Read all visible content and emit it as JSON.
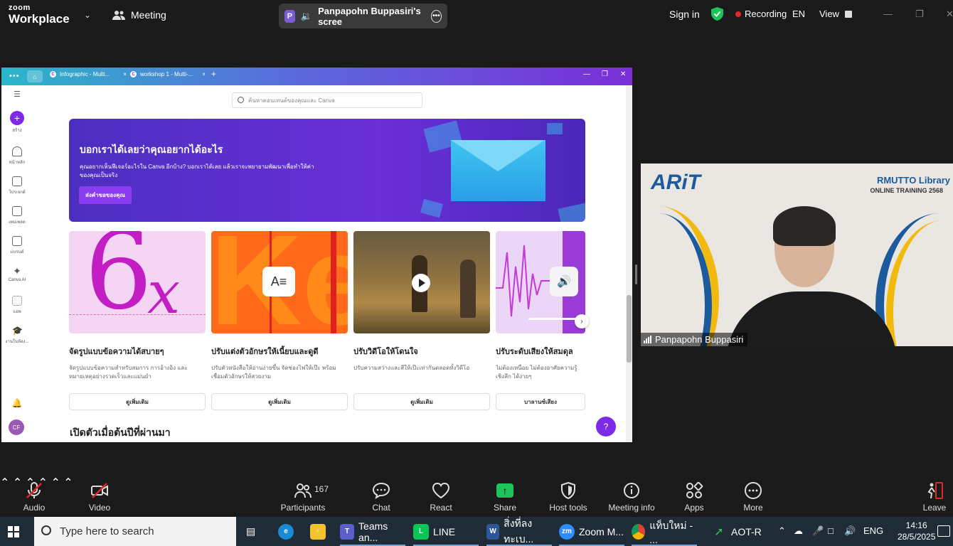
{
  "zoom": {
    "logo_line1": "zoom",
    "logo_line2": "Workplace",
    "meeting_label": "Meeting",
    "share_badge": "P",
    "share_label": "Panpapohn Buppasiri's scree",
    "sign_in": "Sign in",
    "recording": "Recording",
    "language": "EN",
    "view": "View",
    "accent_green": "#1ec45a",
    "recording_color": "#e02828"
  },
  "canva": {
    "tabs": [
      {
        "label": "Infographic - Multi..."
      },
      {
        "label": "workshop 1 - Multi-..."
      }
    ],
    "search_placeholder": "ค้นหาคอนเทนต์ของคุณและ Canva",
    "sidebar": [
      {
        "label": "สร้าง"
      },
      {
        "label": "หน้าหลัก"
      },
      {
        "label": "โปรเจกต์"
      },
      {
        "label": "เทมเพลต"
      },
      {
        "label": "แบรนด์"
      },
      {
        "label": "Canva AI"
      },
      {
        "label": "แอพ"
      },
      {
        "label": "งานในห้อง..."
      }
    ],
    "avatar_initials": "CF",
    "hero": {
      "title": "บอกเราได้เลยว่าคุณอยากได้อะไร",
      "text": "คุณอยากเห็นฟีเจอร์อะไรใน Canva อีกบ้าง? บอกเราได้เลย แล้วเราจะพยายามพัฒนาเพื่อทำให้ค่าของคุณเป็นจริง",
      "button": "ส่งคำขอของคุณ"
    },
    "cards": [
      {
        "title": "จัดรูปแบบข้อความได้สบายๆ",
        "desc": "จัดรูปแบบข้อความสำหรับสมการ การอ้างอิง และหมายเหตุอย่างรวดเร็วและแม่นยำ",
        "button": "ดูเพิ่มเติม",
        "thumb_text_a": "6",
        "thumb_text_b": "x"
      },
      {
        "title": "ปรับแต่งตัวอักษรให้เนี้ยบและดูดี",
        "desc": "ปรับตัวหนังสือให้อ่านง่ายขึ้น จัดช่องไฟให้เป๊ะ พร้อมเชื่อมตัวอักษรให้สวยงาม",
        "button": "ดูเพิ่มเติม",
        "thumb_text_a": "Ke"
      },
      {
        "title": "ปรับวิดีโอให้โดนใจ",
        "desc": "ปรับความสว่างและสีให้เป๊ะเท่ากันตลอดทั้งวิดีโอ",
        "button": "ดูเพิ่มเติม"
      },
      {
        "title": "ปรับระดับเสียงให้สมดุล",
        "desc": "ไม่ต้องเหนื่อย ไม่ต้องอาศัยความรู้เชิงลึก ได้ง่ายๆ",
        "button": "บาลานซ์เสียง"
      }
    ],
    "section_title": "เปิดตัวเมื่อต้นปีที่ผ่านมา",
    "help": "?",
    "brand_purple": "#7d2ae8"
  },
  "video": {
    "brand": "ARiT",
    "library_line1": "RMUTTO Library",
    "library_line2": "ONLINE TRAINING 2568",
    "participant_name": "Panpapohn Buppasiri"
  },
  "toolbar": {
    "audio": "Audio",
    "video": "Video",
    "participants": "Participants",
    "participant_count": "167",
    "chat": "Chat",
    "react": "React",
    "share": "Share",
    "host_tools": "Host tools",
    "meeting_info": "Meeting info",
    "apps": "Apps",
    "more": "More",
    "leave": "Leave"
  },
  "taskbar": {
    "search_placeholder": "Type here to search",
    "apps": [
      {
        "label": "Teams an..."
      },
      {
        "label": "LINE"
      },
      {
        "label": "สิ่งที่ลงทะเบ..."
      },
      {
        "label": "Zoom M..."
      },
      {
        "label": "แท็บใหม่ - ..."
      },
      {
        "label": "AOT-R"
      }
    ],
    "lang": "ENG",
    "time": "14:16",
    "date": "28/5/2025"
  }
}
